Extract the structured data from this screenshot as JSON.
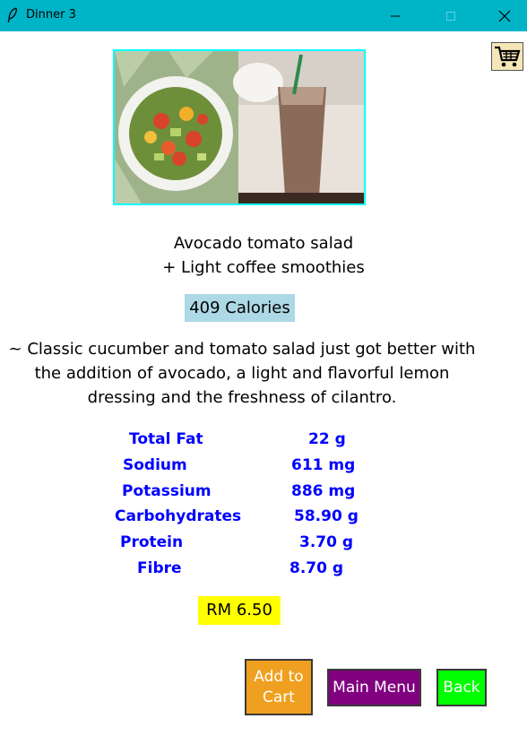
{
  "window": {
    "title": "Dinner 3"
  },
  "dish": {
    "line1": "Avocado tomato salad",
    "line2": "+ Light coffee smoothies"
  },
  "calories": "409 Calories",
  "description": [
    "~ Classic cucumber and tomato salad just got better with",
    "the addition of avocado, a light and flavorful lemon",
    "dressing and the freshness of cilantro."
  ],
  "nutrition": [
    {
      "label": "Total Fat",
      "value": "22 g"
    },
    {
      "label": "Sodium",
      "value": "611 mg"
    },
    {
      "label": "Potassium",
      "value": "886 mg"
    },
    {
      "label": "Carbohydrates",
      "value": "58.90 g"
    },
    {
      "label": "Protein",
      "value": "3.70 g"
    },
    {
      "label": "Fibre",
      "value": "8.70 g"
    }
  ],
  "price": "RM 6.50",
  "buttons": {
    "add_to_cart_line1": "Add to",
    "add_to_cart_line2": "Cart",
    "main_menu": "Main Menu",
    "back": "Back"
  },
  "icons": {
    "title": "feather-icon",
    "cart": "shopping-cart-icon"
  },
  "colors": {
    "titlebar": "#00b4c8",
    "calories_bg": "#add8e6",
    "nutrition_text": "#0000ff",
    "price_bg": "#ffff00",
    "add_cart_bg": "#f0a020",
    "main_menu_bg": "#800080",
    "back_bg": "#00ff00",
    "image_border": "#00ffff"
  }
}
